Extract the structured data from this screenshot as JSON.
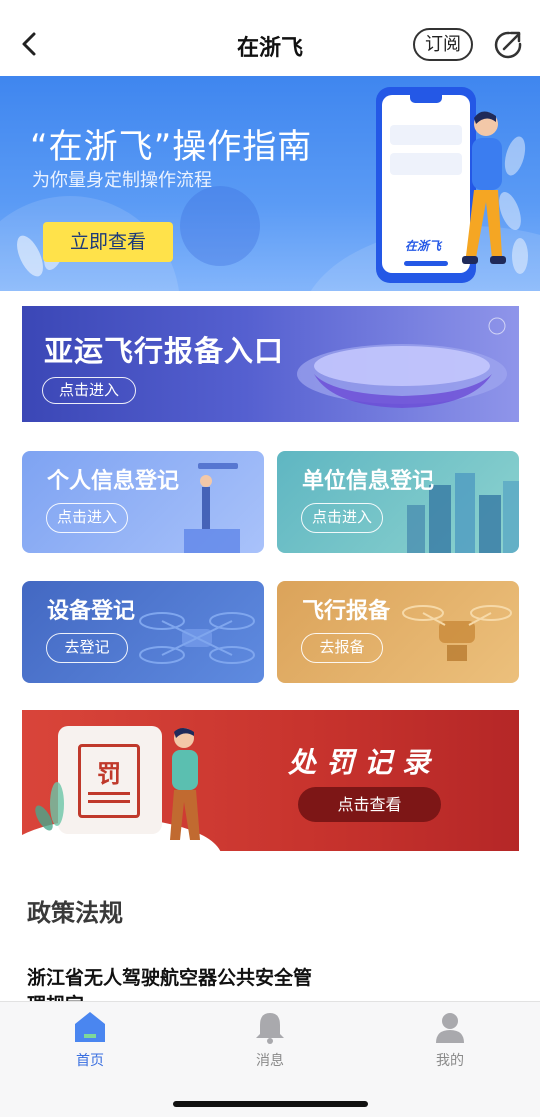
{
  "header": {
    "title": "在浙飞",
    "subscribe_label": "订阅"
  },
  "hero": {
    "title": "“在浙飞”操作指南",
    "subtitle": "为你量身定制操作流程",
    "button_label": "立即查看",
    "phone_brand": "在浙飞"
  },
  "asian_games": {
    "title": "亚运飞行报备入口",
    "button_label": "点击进入"
  },
  "cards": [
    {
      "title": "个人信息登记",
      "button_label": "点击进入",
      "color": "#8fb0f5"
    },
    {
      "title": "单位信息登记",
      "button_label": "点击进入",
      "color": "#6cc6c9"
    },
    {
      "title": "设备登记",
      "button_label": "去登记",
      "color": "#4f79cd"
    },
    {
      "title": "飞行报备",
      "button_label": "去报备",
      "color": "#e2ad63"
    }
  ],
  "penalty": {
    "title": "处罚记录",
    "button_label": "点击查看",
    "icon_text": "罚"
  },
  "policy": {
    "heading": "政策法规",
    "items": [
      {
        "title": "浙江省无人驾驶航空器公共安全管理规定"
      }
    ]
  },
  "tabbar": {
    "items": [
      {
        "label": "首页",
        "icon": "home-icon",
        "active": true
      },
      {
        "label": "消息",
        "icon": "bell-icon",
        "active": false
      },
      {
        "label": "我的",
        "icon": "user-icon",
        "active": false
      }
    ]
  },
  "colors": {
    "primary": "#3a6fe0",
    "hero_button": "#ffe24a",
    "penalty": "#c7332d"
  }
}
